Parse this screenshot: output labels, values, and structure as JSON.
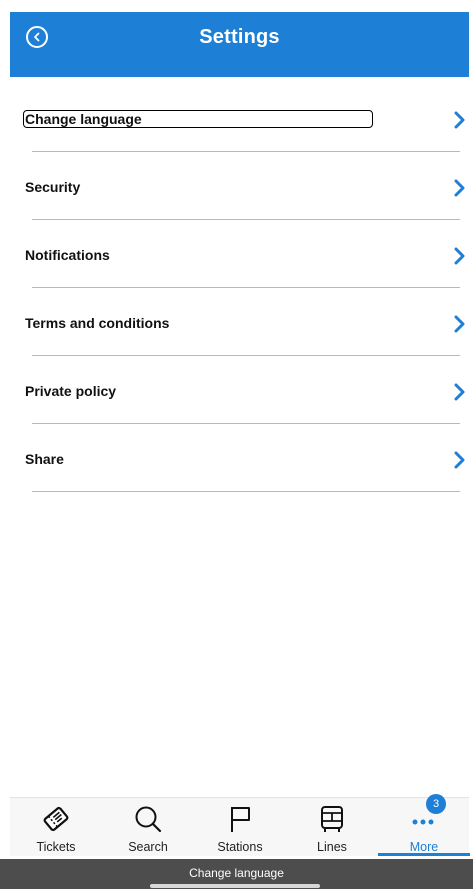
{
  "header": {
    "title": "Settings",
    "back_icon": "back-circle-icon"
  },
  "settings": {
    "items": [
      {
        "label": "Change language",
        "focused": true
      },
      {
        "label": "Security"
      },
      {
        "label": "Notifications"
      },
      {
        "label": "Terms and conditions"
      },
      {
        "label": "Private policy"
      },
      {
        "label": "Share"
      }
    ]
  },
  "tabbar": {
    "tabs": [
      {
        "label": "Tickets",
        "icon": "ticket-icon"
      },
      {
        "label": "Search",
        "icon": "magnifier-icon"
      },
      {
        "label": "Stations",
        "icon": "flag-icon"
      },
      {
        "label": "Lines",
        "icon": "bus-icon"
      },
      {
        "label": "More",
        "icon": "more-dots-icon",
        "badge": "3",
        "active": true
      }
    ]
  },
  "caption": "Change language",
  "colors": {
    "accent": "#1d7fd6",
    "divider": "#b9b9b9"
  }
}
